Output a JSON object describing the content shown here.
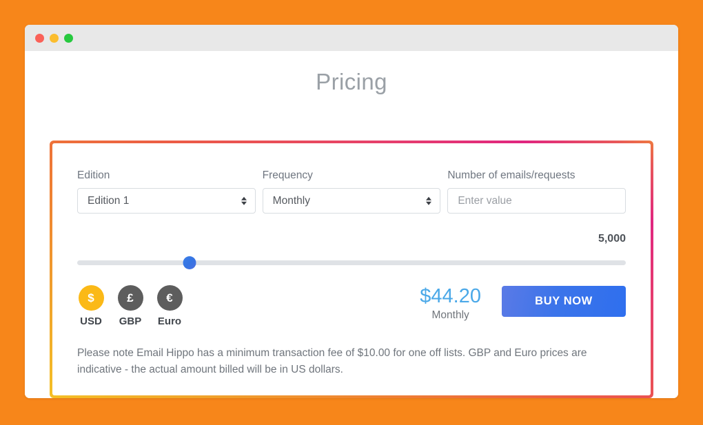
{
  "window": {
    "traffic_lights": [
      "close",
      "minimize",
      "maximize"
    ]
  },
  "page": {
    "title": "Pricing"
  },
  "form": {
    "edition": {
      "label": "Edition",
      "value": "Edition 1"
    },
    "frequency": {
      "label": "Frequency",
      "value": "Monthly"
    },
    "quantity": {
      "label": "Number of emails/requests",
      "value": "",
      "placeholder": "Enter value"
    }
  },
  "slider": {
    "value_display": "5,000",
    "position_percent": 20.5
  },
  "currencies": [
    {
      "code": "USD",
      "symbol": "$",
      "active": true
    },
    {
      "code": "GBP",
      "symbol": "£",
      "active": false
    },
    {
      "code": "Euro",
      "symbol": "€",
      "active": false
    }
  ],
  "price": {
    "amount": "$44.20",
    "period": "Monthly"
  },
  "buy_button": {
    "label": "BUY NOW"
  },
  "note": {
    "text": "Please note Email Hippo has a minimum transaction fee of $10.00 for one off lists. GBP and Euro prices are indicative - the actual amount billed will be in US dollars."
  },
  "colors": {
    "page_background": "#f7861a",
    "accent_blue": "#3b74ea",
    "price_blue": "#4aa8e8",
    "currency_active": "#fbb917",
    "currency_inactive": "#5d5d5d",
    "card_border_gradient_start": "#f5c026",
    "card_border_gradient_end": "#e0267f"
  }
}
